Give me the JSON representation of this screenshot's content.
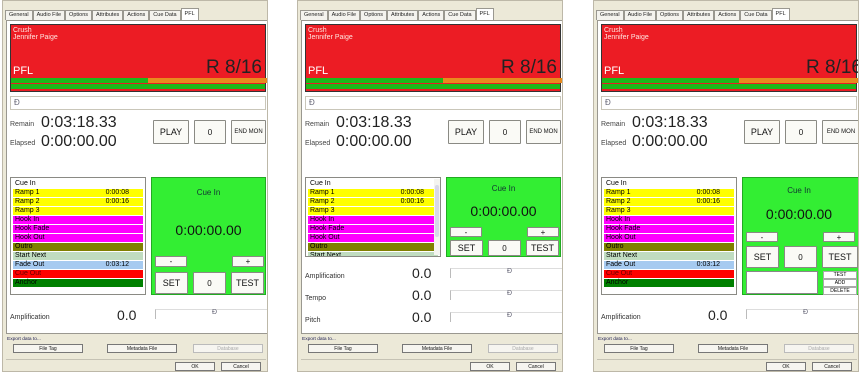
{
  "tabs": [
    "General",
    "Audio File",
    "Options",
    "Attributes",
    "Actions",
    "Cue Data",
    "PFL"
  ],
  "active_tab": "PFL",
  "song": {
    "title": "Crush",
    "artist": "Jennifer Paige"
  },
  "pfl_label": "PFL",
  "r_counter": "R 8/16",
  "level_meter_fraction": 0.92,
  "scrub_thumb": "Đ",
  "remain_label": "Remain",
  "remain_value": "0:03:18.33",
  "elapsed_label": "Elapsed",
  "elapsed_value": "0:00:00.00",
  "play_label": "PLAY",
  "counter_value": "0",
  "end_mon_label": "END MON",
  "cues": [
    {
      "label": "Cue In",
      "time": "",
      "color": "#ffffff"
    },
    {
      "label": "Ramp 1",
      "time": "0:00:08",
      "color": "#ffff00"
    },
    {
      "label": "Ramp 2",
      "time": "0:00:16",
      "color": "#ffff00"
    },
    {
      "label": "Ramp 3",
      "time": "",
      "color": "#ffff00"
    },
    {
      "label": "Hook In",
      "time": "",
      "color": "#ff00ff"
    },
    {
      "label": "Hook Fade",
      "time": "",
      "color": "#ff00ff"
    },
    {
      "label": "Hook Out",
      "time": "",
      "color": "#ff00ff"
    },
    {
      "label": "Outro",
      "time": "",
      "color": "#808000"
    },
    {
      "label": "Start Next",
      "time": "",
      "color": "#c0dcc0"
    },
    {
      "label": "Fade Out",
      "time": "0:03:12",
      "color": "#a6caf0"
    },
    {
      "label": "Cue Out",
      "time": "",
      "color": "#ff0000"
    },
    {
      "label": "Anchor",
      "time": "",
      "color": "#008000"
    }
  ],
  "selected_cue": {
    "name": "Cue In",
    "time": "0:00:00.00"
  },
  "minus_label": "-",
  "plus_label": "+",
  "set_label": "SET",
  "test_label": "TEST",
  "add_label": "ADD",
  "delete_label": "DELETE",
  "amplification": {
    "label": "Amplification",
    "value": "0.0"
  },
  "tempo": {
    "label": "Tempo",
    "value": "0.0"
  },
  "pitch": {
    "label": "Pitch",
    "value": "0.0"
  },
  "export_label": "Export data to...",
  "file_tag_label": "File Tag",
  "metadata_file_label": "Metadata File",
  "database_label": "Database",
  "ok_label": "OK",
  "cancel_label": "Cancel",
  "colors": {
    "red": "#ec1c24",
    "green": "#33ee33",
    "meter_green": "#1eb819",
    "meter_orange": "#e88a1e"
  }
}
